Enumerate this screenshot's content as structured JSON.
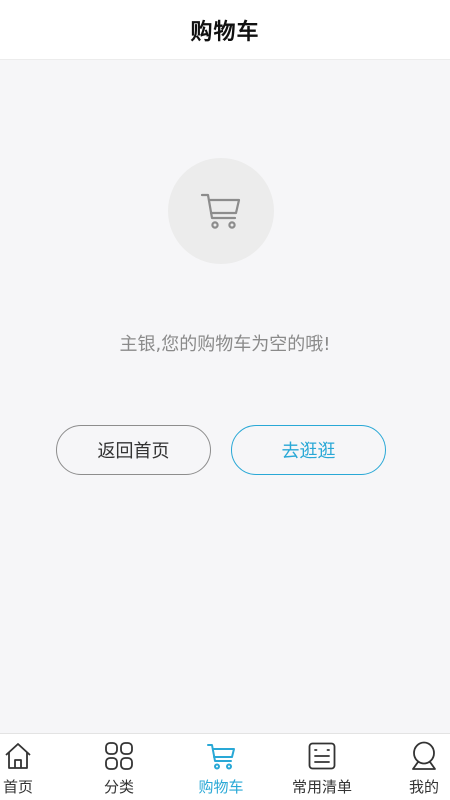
{
  "header": {
    "title": "购物车"
  },
  "empty": {
    "icon": "cart-icon",
    "message": "主银,您的购物车为空的哦!"
  },
  "actions": {
    "back_home_label": "返回首页",
    "go_shopping_label": "去逛逛"
  },
  "tabbar": {
    "active_index": 2,
    "items": [
      {
        "label": "首页",
        "icon": "home-icon"
      },
      {
        "label": "分类",
        "icon": "grid-icon"
      },
      {
        "label": "购物车",
        "icon": "cart-icon"
      },
      {
        "label": "常用清单",
        "icon": "list-icon"
      },
      {
        "label": "我的",
        "icon": "user-icon"
      }
    ]
  },
  "colors": {
    "accent": "#29a8d6",
    "background": "#f6f6f8",
    "text_muted": "#8a8a8a"
  }
}
